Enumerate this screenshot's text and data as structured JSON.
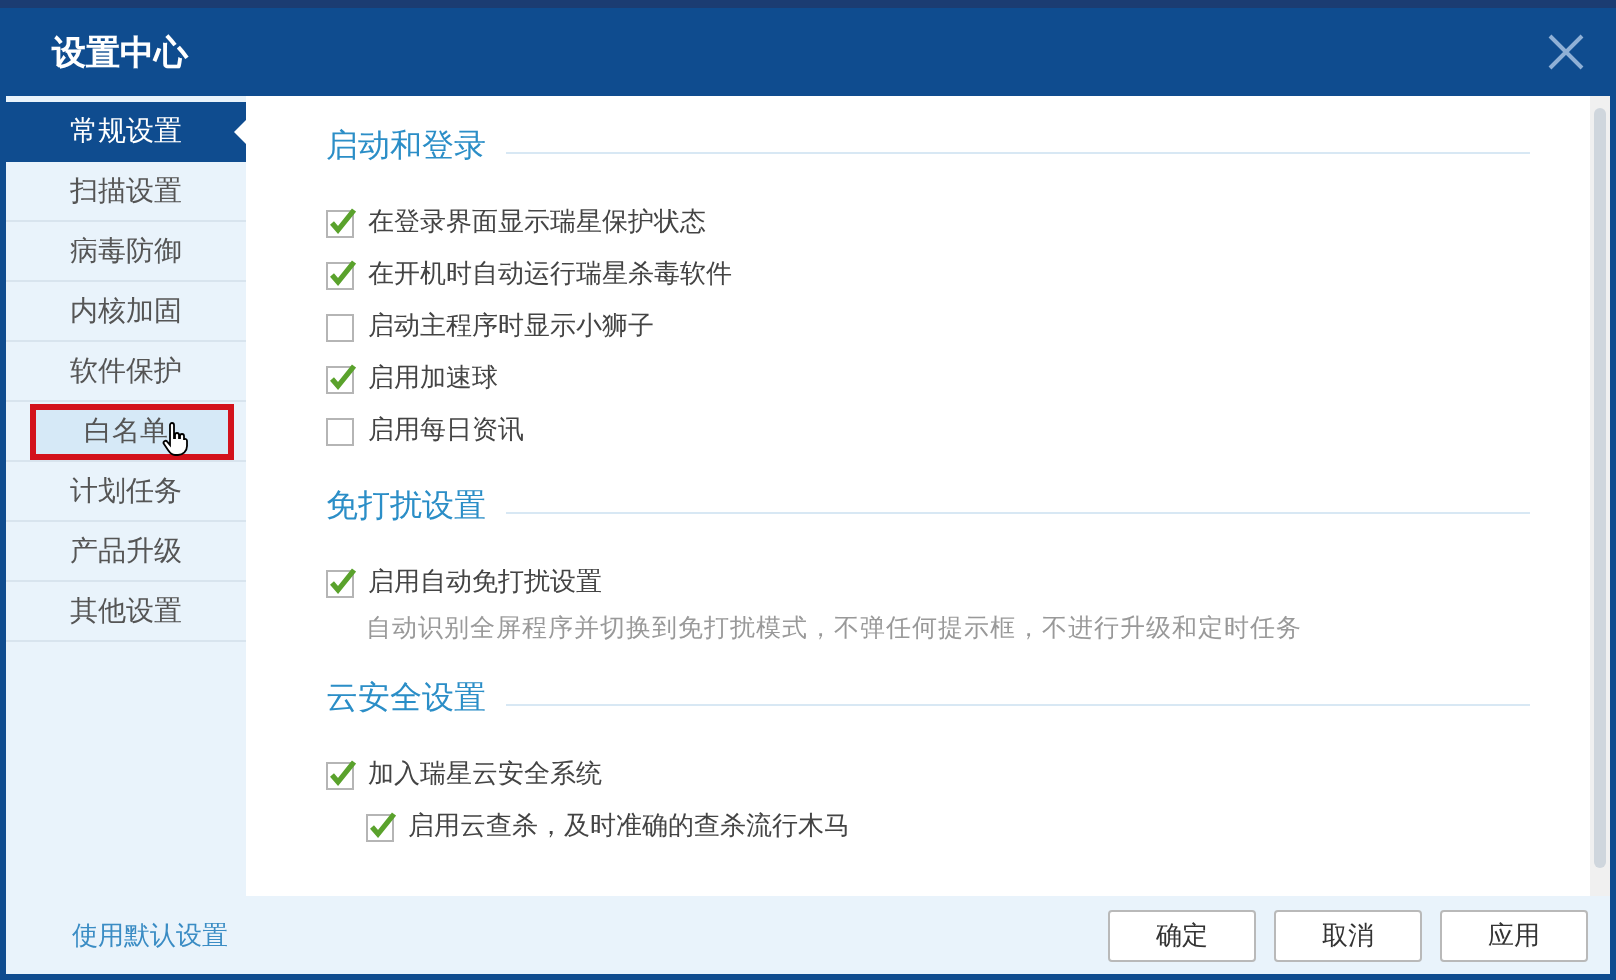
{
  "window": {
    "title": "设置中心"
  },
  "sidebar": {
    "items": [
      {
        "label": "常规设置",
        "selected": true,
        "highlighted": false
      },
      {
        "label": "扫描设置",
        "selected": false,
        "highlighted": false
      },
      {
        "label": "病毒防御",
        "selected": false,
        "highlighted": false
      },
      {
        "label": "内核加固",
        "selected": false,
        "highlighted": false
      },
      {
        "label": "软件保护",
        "selected": false,
        "highlighted": false
      },
      {
        "label": "白名单",
        "selected": false,
        "highlighted": true
      },
      {
        "label": "计划任务",
        "selected": false,
        "highlighted": false
      },
      {
        "label": "产品升级",
        "selected": false,
        "highlighted": false
      },
      {
        "label": "其他设置",
        "selected": false,
        "highlighted": false
      }
    ]
  },
  "sections": [
    {
      "title": "启动和登录",
      "options": [
        {
          "label": "在登录界面显示瑞星保护状态",
          "checked": true
        },
        {
          "label": "在开机时自动运行瑞星杀毒软件",
          "checked": true
        },
        {
          "label": "启动主程序时显示小狮子",
          "checked": false
        },
        {
          "label": "启用加速球",
          "checked": true
        },
        {
          "label": "启用每日资讯",
          "checked": false
        }
      ]
    },
    {
      "title": "免打扰设置",
      "options": [
        {
          "label": "启用自动免打扰设置",
          "checked": true,
          "description": "自动识别全屏程序并切换到免打扰模式，不弹任何提示框，不进行升级和定时任务"
        }
      ]
    },
    {
      "title": "云安全设置",
      "options": [
        {
          "label": "加入瑞星云安全系统",
          "checked": true,
          "children": [
            {
              "label": "启用云查杀，及时准确的查杀流行木马",
              "checked": true
            }
          ]
        }
      ]
    }
  ],
  "footer": {
    "link": "使用默认设置",
    "buttons": [
      "确定",
      "取消",
      "应用"
    ]
  }
}
